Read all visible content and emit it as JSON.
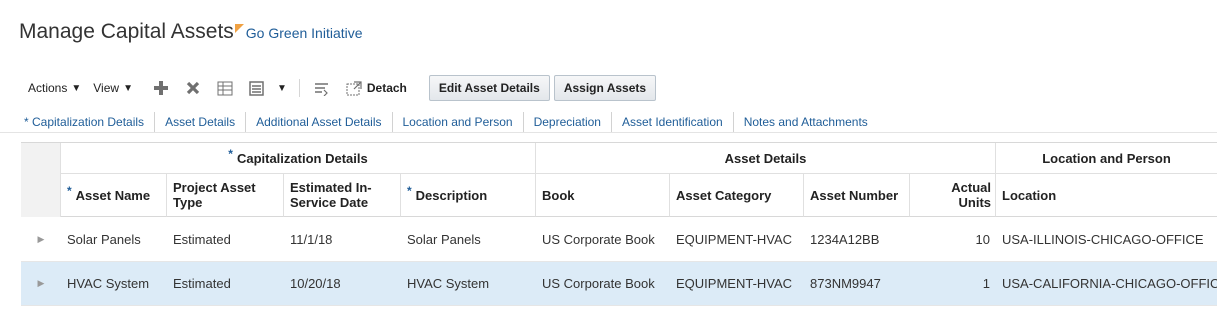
{
  "page": {
    "title": "Manage Capital Assets",
    "title_link": "Go Green Initiative"
  },
  "toolbar": {
    "actions_label": "Actions",
    "view_label": "View",
    "detach_label": "Detach",
    "edit_asset_details_label": "Edit Asset Details",
    "assign_assets_label": "Assign Assets",
    "icons": [
      "add-icon",
      "delete-icon",
      "freeze-icon",
      "columns-icon",
      "wrap-icon",
      "detach-icon"
    ]
  },
  "tabs": [
    "* Capitalization Details",
    "Asset Details",
    "Additional Asset Details",
    "Location and Person",
    "Depreciation",
    "Asset Identification",
    "Notes and Attachments"
  ],
  "table": {
    "required_mark": "*",
    "groups": [
      "Capitalization Details",
      "Asset Details",
      "Location and Person"
    ],
    "columns": {
      "asset_name": "Asset Name",
      "project_asset_type": "Project Asset Type",
      "estimated_in_service_date": "Estimated In-Service Date",
      "description": "Description",
      "book": "Book",
      "asset_category": "Asset Category",
      "asset_number": "Asset Number",
      "actual_units": "Actual Units",
      "location": "Location"
    },
    "rows": [
      {
        "asset_name": "Solar Panels",
        "project_asset_type": "Estimated",
        "estimated_in_service_date": "11/1/18",
        "description": "Solar Panels",
        "book": "US Corporate Book",
        "asset_category": "EQUIPMENT-HVAC",
        "asset_number": "1234A12BB",
        "actual_units": "10",
        "location": "USA-ILLINOIS-CHICAGO-OFFICE"
      },
      {
        "asset_name": "HVAC System",
        "project_asset_type": "Estimated",
        "estimated_in_service_date": "10/20/18",
        "description": "HVAC System",
        "book": "US Corporate Book",
        "asset_category": "EQUIPMENT-HVAC",
        "asset_number": "873NM9947",
        "actual_units": "1",
        "location": "USA-CALIFORNIA-CHICAGO-OFFICE"
      }
    ],
    "selected_row": 1
  },
  "colors": {
    "link": "#1f5d98",
    "title_flag": "#f0a143",
    "selected_row": "#dcebf7"
  }
}
